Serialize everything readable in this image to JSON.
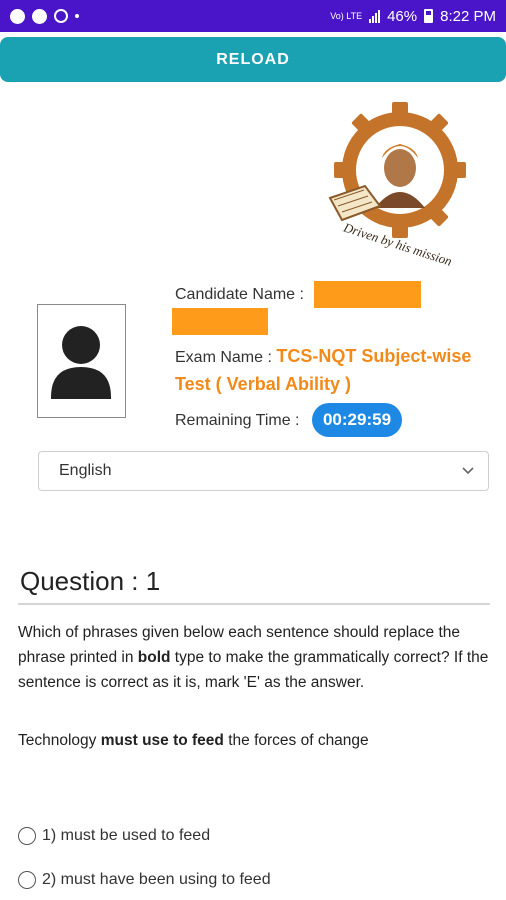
{
  "status_bar": {
    "network": "Vo) LTE",
    "battery": "46%",
    "time": "8:22 PM"
  },
  "header": {
    "reload_label": "RELOAD"
  },
  "logo": {
    "tagline": "Driven by his mission"
  },
  "candidate": {
    "name_label": "Candidate Name :",
    "exam_label": "Exam Name :",
    "exam_name": "TCS-NQT Subject-wise Test ( Verbal Ability )",
    "remaining_label": "Remaining Time :",
    "remaining_time": "00:29:59"
  },
  "language": {
    "selected": "English"
  },
  "question": {
    "title": "Question : 1",
    "instruction_part1": "Which of phrases given below each sentence should replace the phrase printed in ",
    "instruction_bold": "bold",
    "instruction_part2": " type to make the grammatically correct? If the sentence is correct as it is, mark 'E' as the answer.",
    "sentence_part1": "Technology ",
    "sentence_bold": "must use to feed",
    "sentence_part2": " the forces of change",
    "options": [
      {
        "label": "1) must be used to feed"
      },
      {
        "label": "2) must have been using to feed"
      }
    ]
  },
  "colors": {
    "status_bar": "#4a14c8",
    "reload_button": "#1aa2b3",
    "exam_name": "#f28a1a",
    "redaction": "#ff9b1a",
    "timer_badge": "#1e88e5"
  }
}
